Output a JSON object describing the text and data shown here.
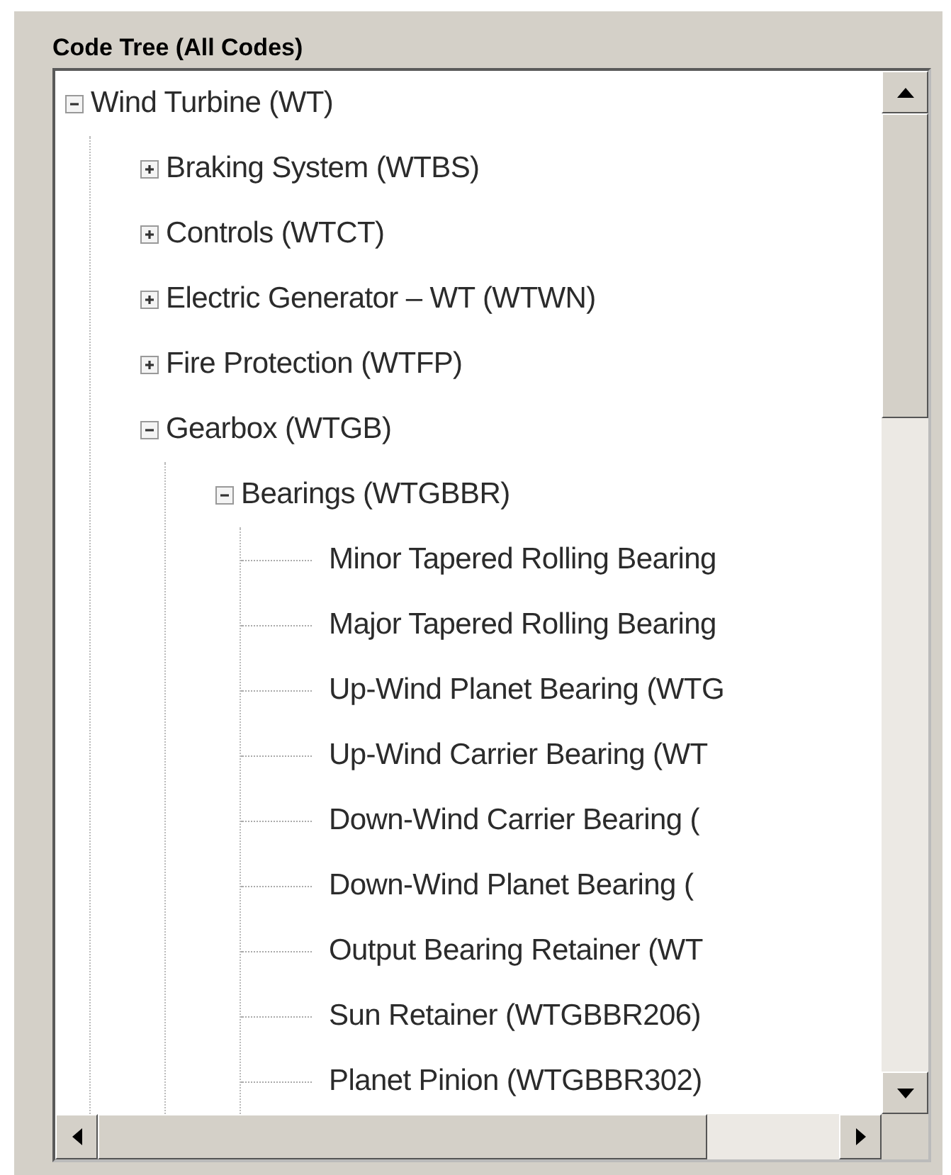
{
  "panel": {
    "title": "Code Tree (All Codes)"
  },
  "tree": [
    {
      "label": "Wind Turbine (WT)",
      "expanded": true,
      "children": [
        {
          "label": "Braking System (WTBS)",
          "expanded": false
        },
        {
          "label": "Controls (WTCT)",
          "expanded": false
        },
        {
          "label": "Electric Generator – WT (WTWN)",
          "expanded": false
        },
        {
          "label": "Fire Protection (WTFP)",
          "expanded": false
        },
        {
          "label": "Gearbox (WTGB)",
          "expanded": true,
          "children": [
            {
              "label": "Bearings (WTGBBR)",
              "expanded": true,
              "children": [
                {
                  "label": "Minor Tapered Rolling Bearing"
                },
                {
                  "label": "Major Tapered Rolling Bearing"
                },
                {
                  "label": "Up-Wind Planet Bearing (WTG"
                },
                {
                  "label": "Up-Wind Carrier Bearing (WT"
                },
                {
                  "label": "Down-Wind Carrier Bearing ("
                },
                {
                  "label": "Down-Wind Planet Bearing ("
                },
                {
                  "label": "Output Bearing Retainer (WT"
                },
                {
                  "label": "Sun Retainer (WTGBBR206)"
                },
                {
                  "label": "Planet Pinion (WTGBBR302)"
                }
              ]
            }
          ]
        }
      ]
    }
  ]
}
